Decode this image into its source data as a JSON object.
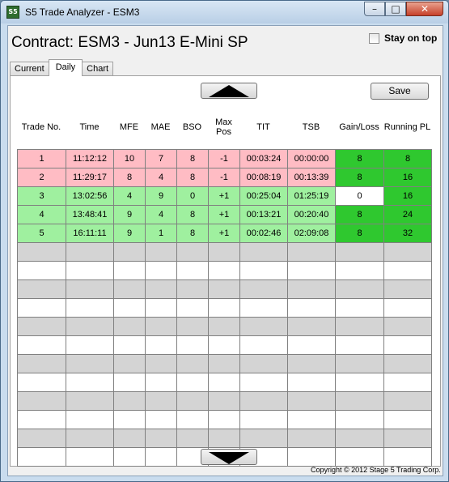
{
  "window": {
    "title": "S5 Trade Analyzer - ESM3",
    "icon_text": "S5",
    "controls": {
      "minimize": "–",
      "maximize": "□",
      "close": "✕"
    }
  },
  "header": {
    "contract_title": "Contract: ESM3 - Jun13 E-Mini SP",
    "stay_on_top_label": "Stay on top",
    "stay_on_top_checked": false
  },
  "tabs": [
    {
      "label": "Current",
      "active": false
    },
    {
      "label": "Daily",
      "active": true
    },
    {
      "label": "Chart",
      "active": false
    }
  ],
  "toolbar": {
    "save_label": "Save",
    "scroll_up_icon": "up-arrow",
    "scroll_down_icon": "down-arrow"
  },
  "table": {
    "columns": [
      {
        "key": "trade_no",
        "label": "Trade No."
      },
      {
        "key": "time",
        "label": "Time"
      },
      {
        "key": "mfe",
        "label": "MFE"
      },
      {
        "key": "mae",
        "label": "MAE"
      },
      {
        "key": "bso",
        "label": "BSO"
      },
      {
        "key": "max_pos",
        "label": "Max\nPos"
      },
      {
        "key": "tit",
        "label": "TIT"
      },
      {
        "key": "tsb",
        "label": "TSB"
      },
      {
        "key": "gain_loss",
        "label": "Gain/Loss"
      },
      {
        "key": "running_pl",
        "label": "Running PL"
      }
    ],
    "rows": [
      {
        "trade_no": "1",
        "time": "11:12:12",
        "mfe": "10",
        "mae": "7",
        "bso": "8",
        "max_pos": "-1",
        "tit": "00:03:24",
        "tsb": "00:00:00",
        "gain_loss": "8",
        "running_pl": "8",
        "status": "loss"
      },
      {
        "trade_no": "2",
        "time": "11:29:17",
        "mfe": "8",
        "mae": "4",
        "bso": "8",
        "max_pos": "-1",
        "tit": "00:08:19",
        "tsb": "00:13:39",
        "gain_loss": "8",
        "running_pl": "16",
        "status": "loss"
      },
      {
        "trade_no": "3",
        "time": "13:02:56",
        "mfe": "4",
        "mae": "9",
        "bso": "0",
        "max_pos": "+1",
        "tit": "00:25:04",
        "tsb": "01:25:19",
        "gain_loss": "0",
        "running_pl": "16",
        "status": "win"
      },
      {
        "trade_no": "4",
        "time": "13:48:41",
        "mfe": "9",
        "mae": "4",
        "bso": "8",
        "max_pos": "+1",
        "tit": "00:13:21",
        "tsb": "00:20:40",
        "gain_loss": "8",
        "running_pl": "24",
        "status": "win"
      },
      {
        "trade_no": "5",
        "time": "16:11:11",
        "mfe": "9",
        "mae": "1",
        "bso": "8",
        "max_pos": "+1",
        "tit": "00:02:46",
        "tsb": "02:09:08",
        "gain_loss": "8",
        "running_pl": "32",
        "status": "win"
      }
    ],
    "empty_rows": 12
  },
  "colors": {
    "loss_row": "#ffbcc4",
    "win_row": "#9ff09f",
    "gain_cell": "#2fc82f",
    "zero_gain_cell": "#ffffff",
    "empty_row_alt": "#d4d4d4"
  },
  "footer": {
    "copyright": "Copyright © 2012 Stage 5 Trading Corp."
  }
}
